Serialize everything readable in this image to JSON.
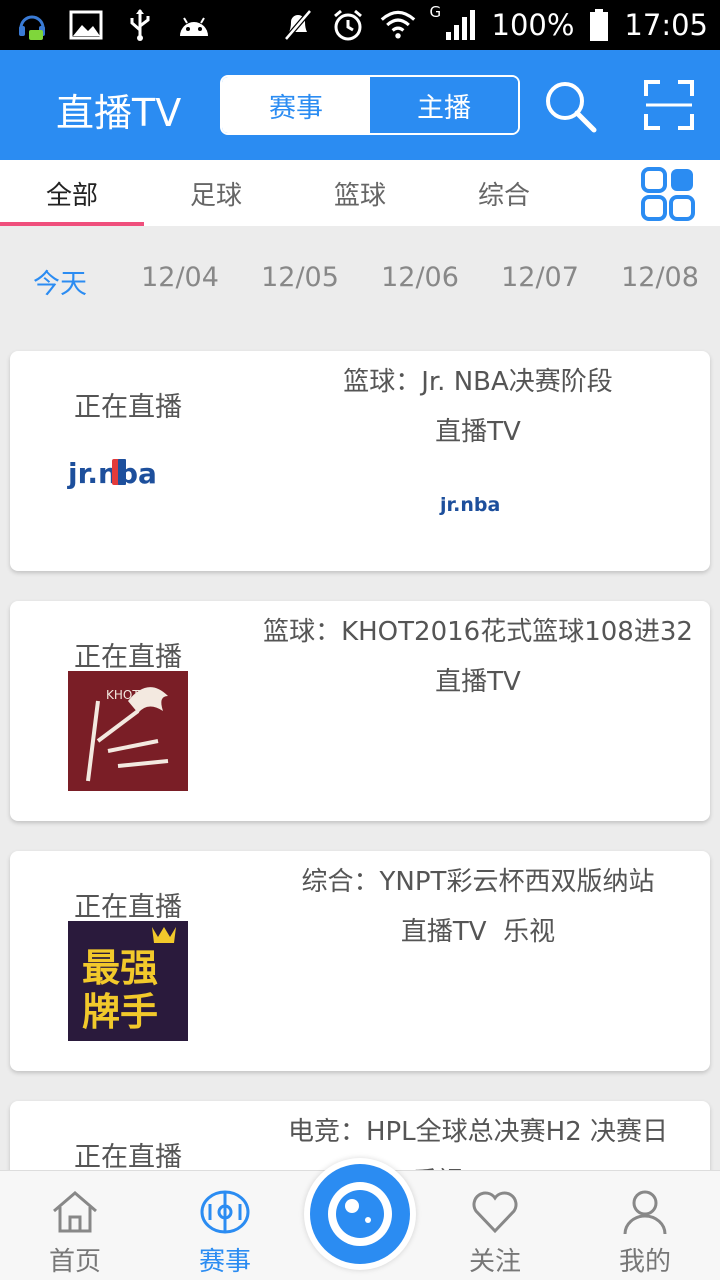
{
  "status_bar": {
    "signal_label": "G",
    "battery": "100%",
    "time": "17:05"
  },
  "header": {
    "title": "直播TV",
    "segments": [
      "赛事",
      "主播"
    ],
    "selected_segment": "赛事"
  },
  "category_tabs": [
    {
      "label": "全部"
    },
    {
      "label": "足球"
    },
    {
      "label": "篮球"
    },
    {
      "label": "综合"
    }
  ],
  "date_strip": [
    {
      "label": "今天"
    },
    {
      "label": "12/04"
    },
    {
      "label": "12/05"
    },
    {
      "label": "12/06"
    },
    {
      "label": "12/07"
    },
    {
      "label": "12/08"
    }
  ],
  "events": [
    {
      "status": "正在直播",
      "title": "篮球：Jr. NBA决赛阶段",
      "platforms": "直播TV",
      "logo_text": "jr.nba",
      "platform_logo_text": "jr.nba"
    },
    {
      "status": "正在直播",
      "title": "篮球：KHOT2016花式篮球108进32",
      "platforms": "直播TV",
      "logo_text": "KHOT"
    },
    {
      "status": "正在直播",
      "title": "综合：YNPT彩云杯西双版纳站",
      "platforms": "直播TV  乐视",
      "logo_text": "最强牌手"
    },
    {
      "status": "正在直播",
      "title": "电竞：HPL全球总决赛H2 决赛日",
      "platforms": "乐视  PPTV"
    }
  ],
  "bottom_nav": [
    {
      "label": "首页",
      "icon": "home-icon"
    },
    {
      "label": "赛事",
      "icon": "stadium-icon"
    },
    {
      "label": "关注",
      "icon": "heart-icon"
    },
    {
      "label": "我的",
      "icon": "person-icon"
    }
  ],
  "colors": {
    "primary": "#2b8cf2",
    "tab_indicator": "#ef4f7c",
    "background": "#ececec"
  }
}
